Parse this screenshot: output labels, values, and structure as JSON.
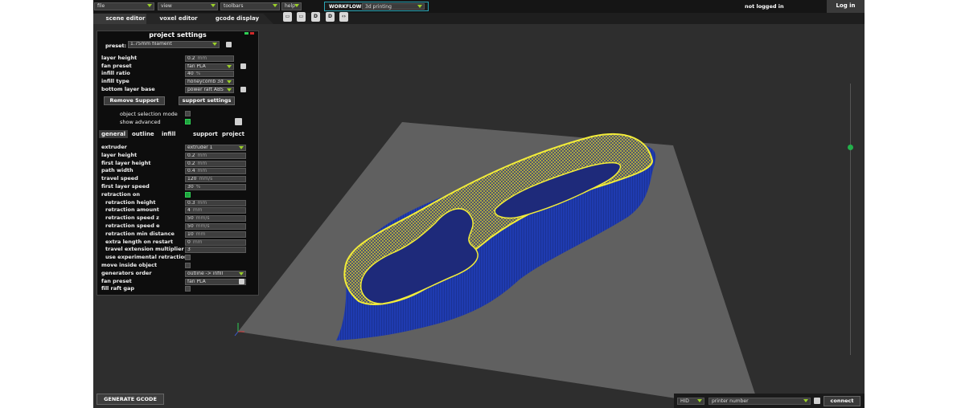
{
  "menu": {
    "file": "file",
    "view": "view",
    "toolbars": "toolbars",
    "help": "help"
  },
  "workflow": {
    "label": "WORKFLOW:",
    "value": "3d printing"
  },
  "auth": {
    "status": "not logged in",
    "login": "Log in"
  },
  "tabs": [
    "scene editor",
    "voxel editor",
    "gcode display"
  ],
  "toolbar_icons": [
    "save-icon",
    "save-as-icon",
    "export-icon",
    "export-alt-icon",
    "code-icon"
  ],
  "panel": {
    "title": "project settings",
    "preset_label": "preset:",
    "preset_value": "1.75mm filament",
    "top_rows": [
      {
        "label": "layer height",
        "value": "0.2",
        "unit": "mm",
        "kind": "field"
      },
      {
        "label": "fan preset",
        "value": "fan PLA",
        "unit": "",
        "kind": "select"
      },
      {
        "label": "infill ratio",
        "value": "40",
        "unit": "%",
        "kind": "field"
      },
      {
        "label": "infill type",
        "value": "honeycomb 3d",
        "unit": "",
        "kind": "select"
      },
      {
        "label": "bottom layer base",
        "value": "power raft ABS",
        "unit": "",
        "kind": "select"
      }
    ],
    "remove_support": "Remove Support",
    "support_settings": "support settings",
    "object_selection_mode": "object selection mode",
    "show_advanced": "show advanced",
    "subtabs": [
      "general",
      "outline",
      "infill",
      "support",
      "project"
    ],
    "general_rows": [
      {
        "label": "extruder",
        "value": "extruder 1",
        "unit": "",
        "kind": "select",
        "indent": false
      },
      {
        "label": "layer height",
        "value": "0.2",
        "unit": "mm",
        "kind": "field",
        "indent": false
      },
      {
        "label": "first layer height",
        "value": "0.2",
        "unit": "mm",
        "kind": "field",
        "indent": false
      },
      {
        "label": "path width",
        "value": "0.4",
        "unit": "mm",
        "kind": "field",
        "indent": false
      },
      {
        "label": "travel speed",
        "value": "120",
        "unit": "mm/s",
        "kind": "field",
        "indent": false
      },
      {
        "label": "first layer speed",
        "value": "30",
        "unit": "%",
        "kind": "field",
        "indent": false
      },
      {
        "label": "retraction on",
        "value": "",
        "unit": "",
        "kind": "check-on",
        "indent": false
      },
      {
        "label": "retraction height",
        "value": "0.3",
        "unit": "mm",
        "kind": "field",
        "indent": true
      },
      {
        "label": "retraction amount",
        "value": "4",
        "unit": "mm",
        "kind": "field",
        "indent": true
      },
      {
        "label": "retraction speed z",
        "value": "50",
        "unit": "mm/s",
        "kind": "field",
        "indent": true
      },
      {
        "label": "retraction speed e",
        "value": "50",
        "unit": "mm/s",
        "kind": "field",
        "indent": true
      },
      {
        "label": "retraction min distance",
        "value": "10",
        "unit": "mm",
        "kind": "field",
        "indent": true
      },
      {
        "label": "extra length on restart",
        "value": "0",
        "unit": "mm",
        "kind": "field",
        "indent": true
      },
      {
        "label": "travel extension multiplier",
        "value": "3",
        "unit": "",
        "kind": "field",
        "indent": true
      },
      {
        "label": "use experimental retraction",
        "value": "",
        "unit": "",
        "kind": "check",
        "indent": true
      },
      {
        "label": "move inside object",
        "value": "",
        "unit": "",
        "kind": "check",
        "indent": false
      },
      {
        "label": "generators order",
        "value": "outline -> infill",
        "unit": "",
        "kind": "select",
        "indent": false
      },
      {
        "label": "fan preset",
        "value": "fan PLA",
        "unit": "",
        "kind": "select",
        "indent": false
      },
      {
        "label": "fill raft gap",
        "value": "",
        "unit": "",
        "kind": "check",
        "indent": false
      }
    ]
  },
  "generate_gcode": "GENERATE GCODE",
  "connection": {
    "port": "HID",
    "printer": "printer number",
    "connect": "connect"
  },
  "colors": {
    "bed": "#5f5f5f",
    "model_wall": "#1e3aa8",
    "model_infill": "#e8e046",
    "accent_green": "#9bd02a",
    "workflow_border": "#2aa5b5"
  }
}
